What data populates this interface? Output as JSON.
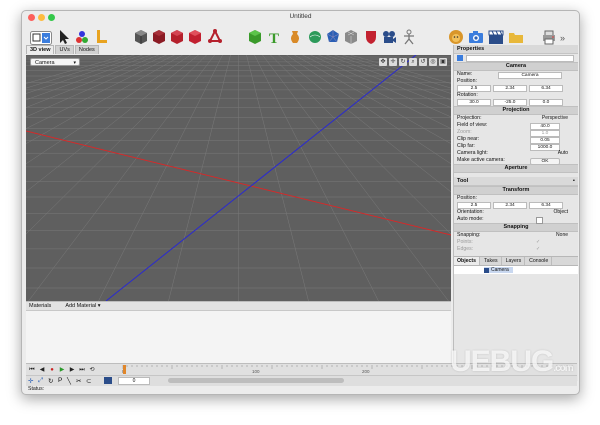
{
  "window": {
    "title": "Untitled"
  },
  "view_tabs": [
    "3D view",
    "UVs",
    "Nodes"
  ],
  "viewport": {
    "camera_select": "Camera"
  },
  "materials": {
    "label": "Materials",
    "add_button": "Add Material"
  },
  "properties": {
    "title": "Properties",
    "camera_section": "Camera",
    "name_label": "Name:",
    "name_value": "Camera",
    "position_label": "Position:",
    "position": [
      "2.5",
      "2.34",
      "6.34"
    ],
    "rotation_label": "Rotation:",
    "rotation": [
      "30.0",
      "-25.0",
      "0.0"
    ],
    "projection_section": "Projection",
    "projection_label": "Projection:",
    "projection_value": "Perspective",
    "fov_label": "Field of view:",
    "fov_value": "40.0",
    "zoom_label": "Zoom:",
    "zoom_value": "1.0",
    "clip_near_label": "Clip near:",
    "clip_near_value": "0.05",
    "clip_far_label": "Clip far:",
    "clip_far_value": "1000.0",
    "camera_light_label": "Camera light:",
    "camera_light_value": "Auto",
    "make_active_label": "Make active camera:",
    "make_active_button": "OK",
    "aperture_section": "Aperture"
  },
  "tool": {
    "title": "Tool",
    "transform_section": "Transform",
    "position_label": "Position:",
    "position": [
      "2.5",
      "2.34",
      "6.34"
    ],
    "orientation_label": "Orientation:",
    "orientation_value": "Object",
    "auto_mode_label": "Auto mode:",
    "snapping_section": "Snapping",
    "snapping_label": "Snapping:",
    "snapping_value": "None",
    "points_label": "Points:",
    "edges_label": "Edges:"
  },
  "objects_tabs": [
    "Objects",
    "Takes",
    "Layers",
    "Console"
  ],
  "objects_list": [
    {
      "name": "Camera"
    }
  ],
  "timeline": {
    "frame_value": "0",
    "ticks": [
      "0",
      "100",
      "200"
    ]
  },
  "status": {
    "label": "Status:"
  },
  "watermark": {
    "text": "UEBUG",
    "suffix": ".com"
  },
  "colors": {
    "viewport_bg": "#5f5f5f",
    "x_axis": "#d42a2a",
    "z_axis": "#2a2ad0",
    "accent": "#3b7ddd"
  }
}
